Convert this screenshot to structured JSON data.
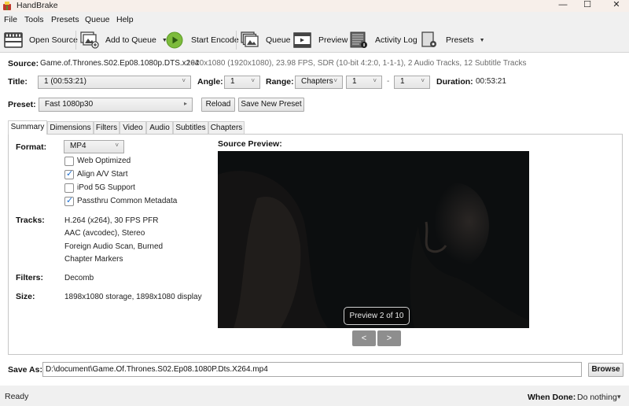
{
  "window": {
    "title": "HandBrake",
    "controls": {
      "minimize": "—",
      "maximize": "☐",
      "close": "✕"
    }
  },
  "menu": [
    "File",
    "Tools",
    "Presets",
    "Queue",
    "Help"
  ],
  "toolbar": {
    "open_source": "Open Source",
    "add_to_queue": "Add to Queue",
    "start_encode": "Start Encode",
    "queue": "Queue",
    "preview": "Preview",
    "activity_log": "Activity Log",
    "presets": "Presets",
    "dropdown_glyph": "▼"
  },
  "source": {
    "label": "Source:",
    "name": "Game.of.Thrones.S02.Ep08.1080p.DTS.x264",
    "info": "1920x1080 (1920x1080), 23.98 FPS, SDR (10-bit 4:2:0, 1-1-1), 2 Audio Tracks, 12 Subtitle Tracks"
  },
  "title_row": {
    "title_label": "Title:",
    "title_value": "1  (00:53:21)",
    "angle_label": "Angle:",
    "angle_value": "1",
    "range_label": "Range:",
    "range_type": "Chapters",
    "range_start": "1",
    "range_sep": "-",
    "range_end": "1",
    "duration_label": "Duration:",
    "duration_value": "00:53:21",
    "chevron": "˅"
  },
  "preset_row": {
    "label": "Preset:",
    "value": "Fast 1080p30",
    "arrow": "▸",
    "reload": "Reload",
    "save_new": "Save New Preset"
  },
  "tabs": [
    "Summary",
    "Dimensions",
    "Filters",
    "Video",
    "Audio",
    "Subtitles",
    "Chapters"
  ],
  "active_tab": "Summary",
  "summary": {
    "format_label": "Format:",
    "format_value": "MP4",
    "options": [
      {
        "label": "Web Optimized",
        "checked": false
      },
      {
        "label": "Align A/V Start",
        "checked": true
      },
      {
        "label": "iPod 5G Support",
        "checked": false
      },
      {
        "label": "Passthru Common Metadata",
        "checked": true
      }
    ],
    "check_glyph": "✓",
    "tracks_label": "Tracks:",
    "tracks": [
      "H.264 (x264), 30 FPS PFR",
      "AAC (avcodec), Stereo",
      "Foreign Audio Scan, Burned",
      "Chapter Markers"
    ],
    "filters_label": "Filters:",
    "filters_value": "Decomb",
    "size_label": "Size:",
    "size_value": "1898x1080 storage, 1898x1080 display"
  },
  "preview": {
    "label": "Source Preview:",
    "badge": "Preview 2 of 10",
    "current": 2,
    "total": 10,
    "prev": "<",
    "next": ">"
  },
  "save_as": {
    "label": "Save As:",
    "path": "D:\\document\\Game.Of.Thrones.S02.Ep08.1080P.Dts.X264.mp4",
    "browse": "Browse"
  },
  "status": {
    "text": "Ready",
    "when_done_label": "When Done:",
    "when_done_value": "Do nothing",
    "caret": "▾"
  }
}
